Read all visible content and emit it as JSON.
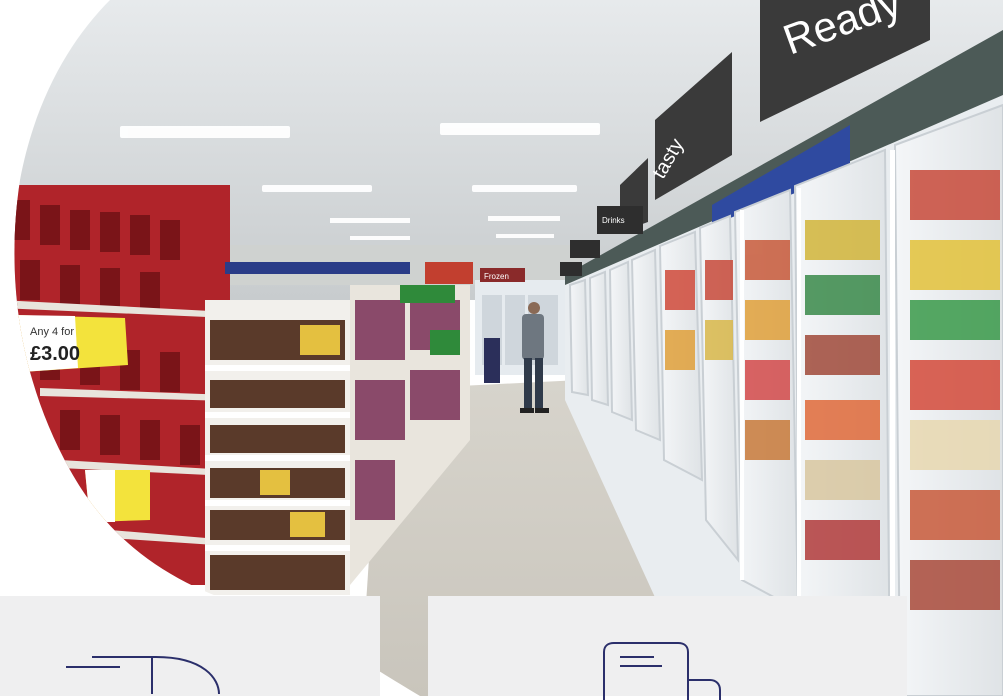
{
  "scene": {
    "subject": "supermarket-aisle",
    "signs": {
      "ready": "Ready",
      "tasty": "tasty",
      "frozen": "Frozen",
      "drinks": "Drinks",
      "price_tag": "Any 4 for",
      "price_value": "£3.00"
    }
  },
  "cards": [
    {
      "icon": "delivery-truck-icon"
    },
    {
      "icon": "documents-icon"
    }
  ],
  "colors": {
    "card_bg": "#efeff0",
    "icon_stroke": "#2b2f6b",
    "ceiling": "#dfe3e6",
    "floor": "#d9d6d0",
    "sign_dark": "#3a3a3a",
    "price_yellow": "#f3e33c",
    "shelf_red": "#b0242a"
  }
}
